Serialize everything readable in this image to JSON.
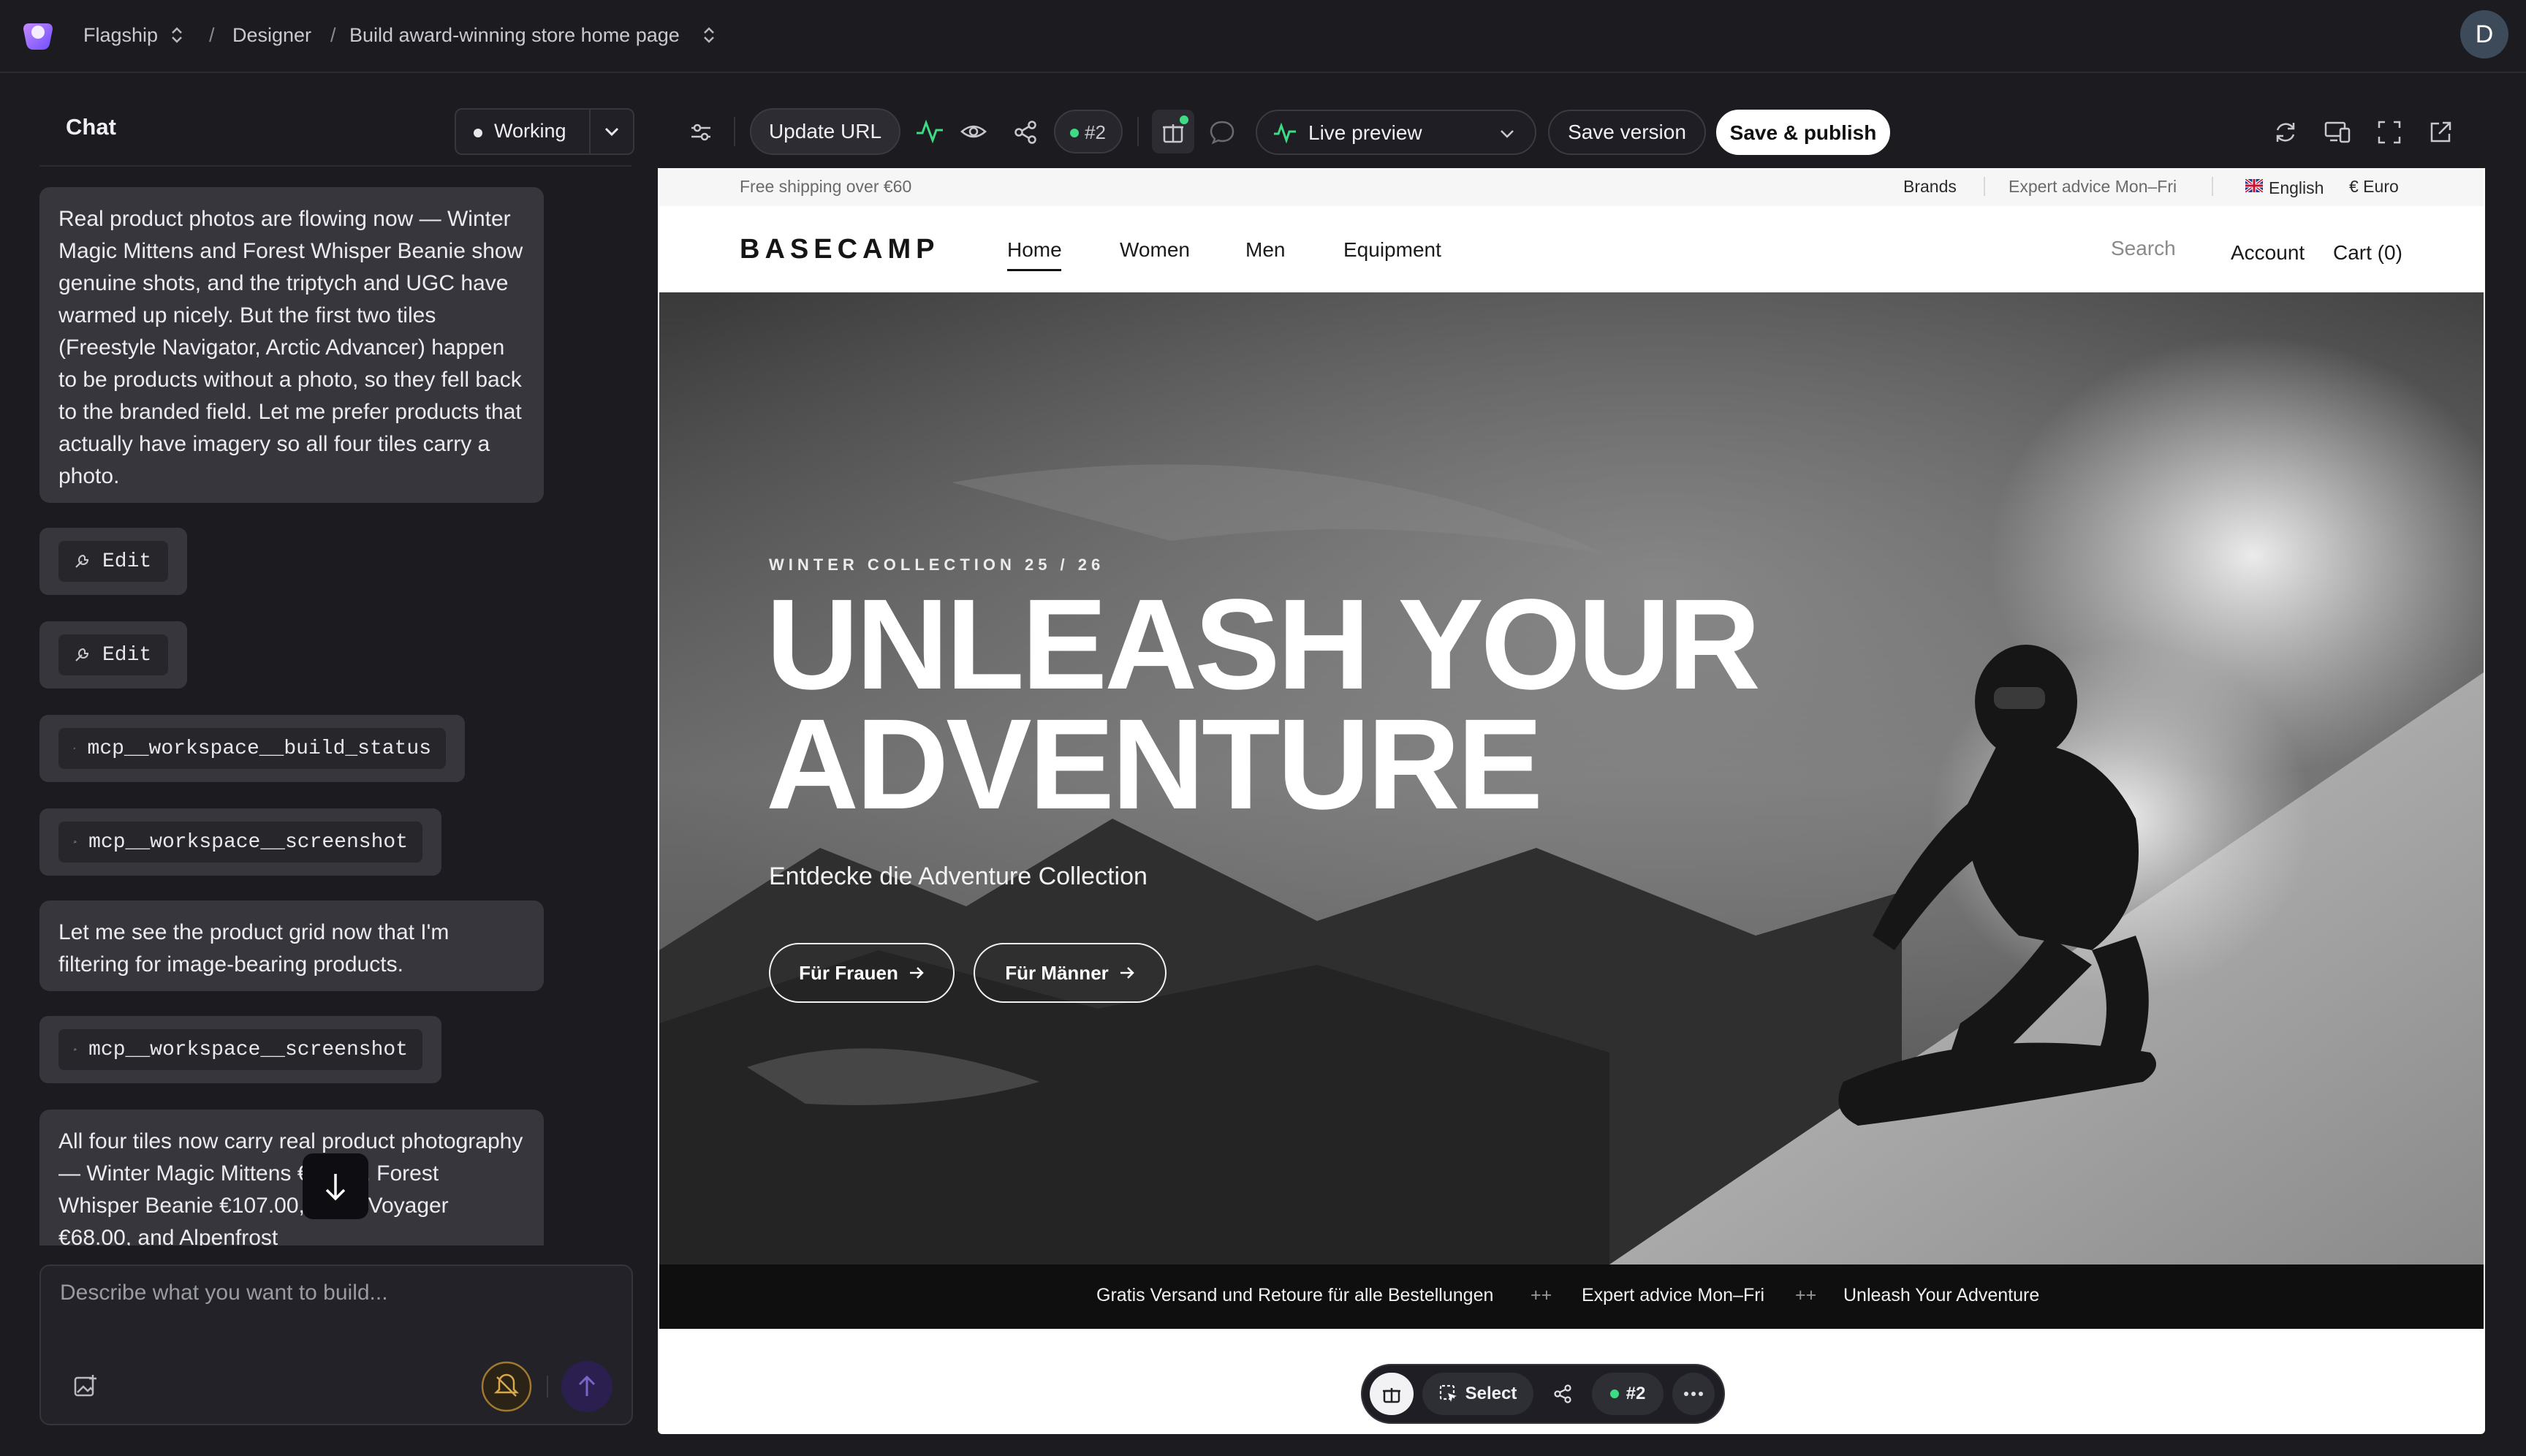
{
  "topbar": {
    "project": "Flagship",
    "sep": "/",
    "section": "Designer",
    "page": "Build award-winning store home page",
    "avatar_letter": "D"
  },
  "chat": {
    "title": "Chat",
    "status": "Working",
    "messages": [
      "Real product photos are flowing now — Winter Magic Mittens and Forest Whisper Beanie show genuine shots, and the triptych and UGC have warmed up nicely. But the first two tiles (Freestyle Navigator, Arctic Advancer) happen to be products without a photo, so they fell back to the branded field. Let me prefer products that actually have imagery so all four tiles carry a photo.",
      "Let me see the product grid now that I'm filtering for image-bearing products.",
      "All four tiles now carry real product photography — Winter Magic Mittens €52.00, Forest Whisper Beanie €107.00, Polar Voyager €68.00, and Alpenfrost"
    ],
    "tools": [
      "Edit",
      "Edit",
      "mcp__workspace__build_status",
      "mcp__workspace__screenshot",
      "mcp__workspace__screenshot"
    ],
    "input_placeholder": "Describe what you want to build..."
  },
  "toolbar": {
    "update_url": "Update URL",
    "badge": "#2",
    "live_preview": "Live preview",
    "save_version": "Save version",
    "save_publish": "Save & publish"
  },
  "site": {
    "announce_left": "Free shipping over €60",
    "announce_brands": "Brands",
    "announce_advice": "Expert advice Mon–Fri",
    "language": "English",
    "currency": "€ Euro",
    "brand": "BASECAMP",
    "nav": [
      "Home",
      "Women",
      "Men",
      "Equipment"
    ],
    "search": "Search",
    "account": "Account",
    "cart": "Cart (0)",
    "hero": {
      "eyebrow": "WINTER COLLECTION 25 / 26",
      "line1": "UNLEASH YOUR",
      "line2": "ADVENTURE",
      "sub": "Entdecke die Adventure Collection",
      "btn1": "Für Frauen",
      "btn2": "Für Männer"
    },
    "ticker": {
      "item1": "Gratis Versand und Retoure für alle Bestellungen",
      "sep": "++",
      "item2": "Expert advice Mon–Fri",
      "item3": "Unleash Your Adventure"
    }
  },
  "floatbar": {
    "select": "Select",
    "badge": "#2"
  },
  "colors": {
    "app_bg": "#1b1b20",
    "bubble": "#36363c",
    "accent_green": "#3ddc84",
    "send_purple": "#2a1f4f"
  }
}
